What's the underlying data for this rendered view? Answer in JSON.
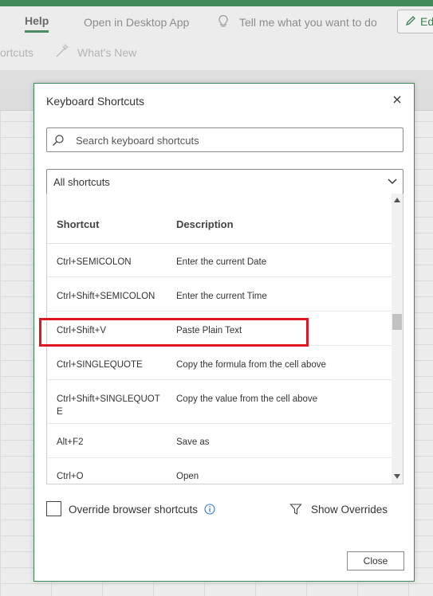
{
  "ribbon": {
    "tab_help": "Help",
    "open_desktop": "Open in Desktop App",
    "tell_me": "Tell me what you want to do",
    "edit_partial": "Ed",
    "shortcuts_partial": "ortcuts",
    "whats_new": "What's New"
  },
  "dialog": {
    "title": "Keyboard Shortcuts",
    "search_placeholder": "Search keyboard shortcuts",
    "filter_value": "All shortcuts",
    "columns": {
      "shortcut": "Shortcut",
      "description": "Description"
    },
    "rows": [
      {
        "key": "Ctrl+SEMICOLON",
        "desc": "Enter the current Date"
      },
      {
        "key": "Ctrl+Shift+SEMICOLON",
        "desc": "Enter the current Time"
      },
      {
        "key": "Ctrl+Shift+V",
        "desc": "Paste Plain Text"
      },
      {
        "key": "Ctrl+SINGLEQUOTE",
        "desc": "Copy the formula from the cell above"
      },
      {
        "key": "Ctrl+Shift+SINGLEQUOT\nE",
        "desc": "Copy the value from the cell above"
      },
      {
        "key": "Alt+F2",
        "desc": "Save as"
      },
      {
        "key": "Ctrl+O",
        "desc": "Open"
      }
    ],
    "override_label": "Override browser shortcuts",
    "show_overrides": "Show Overrides",
    "close_label": "Close"
  },
  "colors": {
    "accent_green": "#3f8a58",
    "highlight_red": "#e0161e",
    "info_blue": "#2b78d6"
  },
  "icons": [
    "lightbulb-icon",
    "pencil-icon",
    "magic-wand-icon",
    "close-icon",
    "search-icon",
    "chevron-down-icon",
    "info-icon",
    "filter-icon",
    "scroll-up-icon",
    "scroll-down-icon"
  ]
}
